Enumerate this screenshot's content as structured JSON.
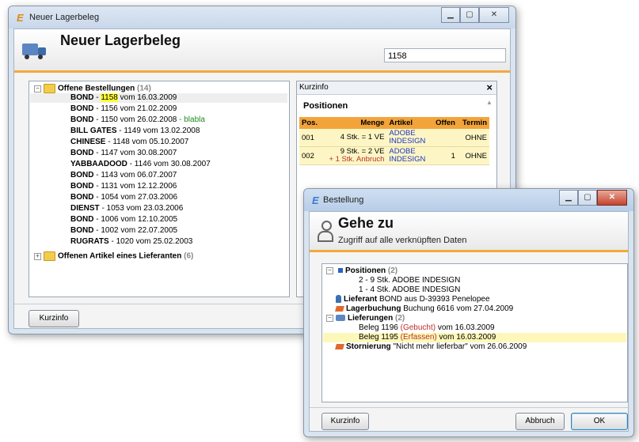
{
  "main_window": {
    "title": "Neuer Lagerbeleg",
    "header_title": "Neuer Lagerbeleg",
    "search_value": "1158",
    "kurzinfo_button": "Kurzinfo",
    "tree": {
      "group1_label": "Offene Bestellungen",
      "group1_count": "(14)",
      "items": [
        {
          "name": "BOND",
          "rest": " - ",
          "hl": "1158",
          "rest2": " vom 16.03.2009",
          "note": ""
        },
        {
          "name": "BOND",
          "rest": " - 1156 vom 21.02.2009",
          "hl": "",
          "rest2": "",
          "note": ""
        },
        {
          "name": "BOND",
          "rest": " - 1150 vom 26.02.2008",
          "hl": "",
          "rest2": "",
          "note": " - blabla"
        },
        {
          "name": "BILL GATES",
          "rest": " - 1149 vom 13.02.2008",
          "hl": "",
          "rest2": "",
          "note": ""
        },
        {
          "name": "CHINESE",
          "rest": " - 1148 vom 05.10.2007",
          "hl": "",
          "rest2": "",
          "note": ""
        },
        {
          "name": "BOND",
          "rest": " - 1147 vom 30.08.2007",
          "hl": "",
          "rest2": "",
          "note": ""
        },
        {
          "name": "YABBAADOOD",
          "rest": " - 1146 vom 30.08.2007",
          "hl": "",
          "rest2": "",
          "note": ""
        },
        {
          "name": "BOND",
          "rest": " - 1143 vom 06.07.2007",
          "hl": "",
          "rest2": "",
          "note": ""
        },
        {
          "name": "BOND",
          "rest": " - 1131 vom 12.12.2006",
          "hl": "",
          "rest2": "",
          "note": ""
        },
        {
          "name": "BOND",
          "rest": " - 1054 vom 27.03.2006",
          "hl": "",
          "rest2": "",
          "note": ""
        },
        {
          "name": "DIENST",
          "rest": " - 1053 vom 23.03.2006",
          "hl": "",
          "rest2": "",
          "note": ""
        },
        {
          "name": "BOND",
          "rest": " - 1006 vom 12.10.2005",
          "hl": "",
          "rest2": "",
          "note": ""
        },
        {
          "name": "BOND",
          "rest": " - 1002 vom 22.07.2005",
          "hl": "",
          "rest2": "",
          "note": ""
        },
        {
          "name": "RUGRATS",
          "rest": " - 1020 vom 25.02.2003",
          "hl": "",
          "rest2": "",
          "note": ""
        }
      ],
      "group2_label": "Offenen Artikel eines Lieferanten",
      "group2_count": "(6)"
    },
    "kurzinfo_panel": {
      "title": "Kurzinfo",
      "close": "×",
      "section": "Positionen",
      "columns": [
        "Pos.",
        "Menge",
        "Artikel",
        "Offen",
        "Termin"
      ],
      "rows": [
        {
          "pos": "001",
          "menge": "4 Stk. = 1  VE",
          "menge2": "",
          "artikel1": "ADOBE",
          "artikel2": "INDESIGN",
          "offen": "",
          "termin": "OHNE"
        },
        {
          "pos": "002",
          "menge": "9 Stk. = 2  VE",
          "menge2": "+ 1 Stk. Anbruch",
          "artikel1": "ADOBE",
          "artikel2": "INDESIGN",
          "offen": "1",
          "termin": "OHNE"
        }
      ]
    }
  },
  "dialog": {
    "title": "Bestellung",
    "header_title": "Gehe zu",
    "header_sub": "Zugriff auf alle verknüpften Daten",
    "tree": {
      "positionen_label": "Positionen",
      "positionen_count": "(2)",
      "pos_items": [
        "2 - 9 Stk. ADOBE INDESIGN",
        "1 - 4 Stk. ADOBE INDESIGN"
      ],
      "lieferant_label": "Lieferant",
      "lieferant_value": " BOND aus D-39393 Penelopee",
      "lagerbuchung_label": "Lagerbuchung",
      "lagerbuchung_value": " Buchung 6616 vom 27.04.2009",
      "lieferungen_label": "Lieferungen",
      "lieferungen_count": "(2)",
      "beleg1_a": "Beleg 1196 ",
      "beleg1_status": "(Gebucht)",
      "beleg1_b": " vom 16.03.2009",
      "beleg2_a": "Beleg 1195 ",
      "beleg2_status": "(Erfassen)",
      "beleg2_b": " vom 16.03.2009",
      "stornierung_label": "Stornierung",
      "stornierung_value": " \"Nicht mehr lieferbar\" vom 26.06.2009"
    },
    "kurzinfo_button": "Kurzinfo",
    "abbruch_button": "Abbruch",
    "ok_button": "OK"
  },
  "colors": {
    "accent_orange": "#f4a93c",
    "highlight_yellow": "#ffff7a",
    "link_blue": "#1a34c8"
  }
}
